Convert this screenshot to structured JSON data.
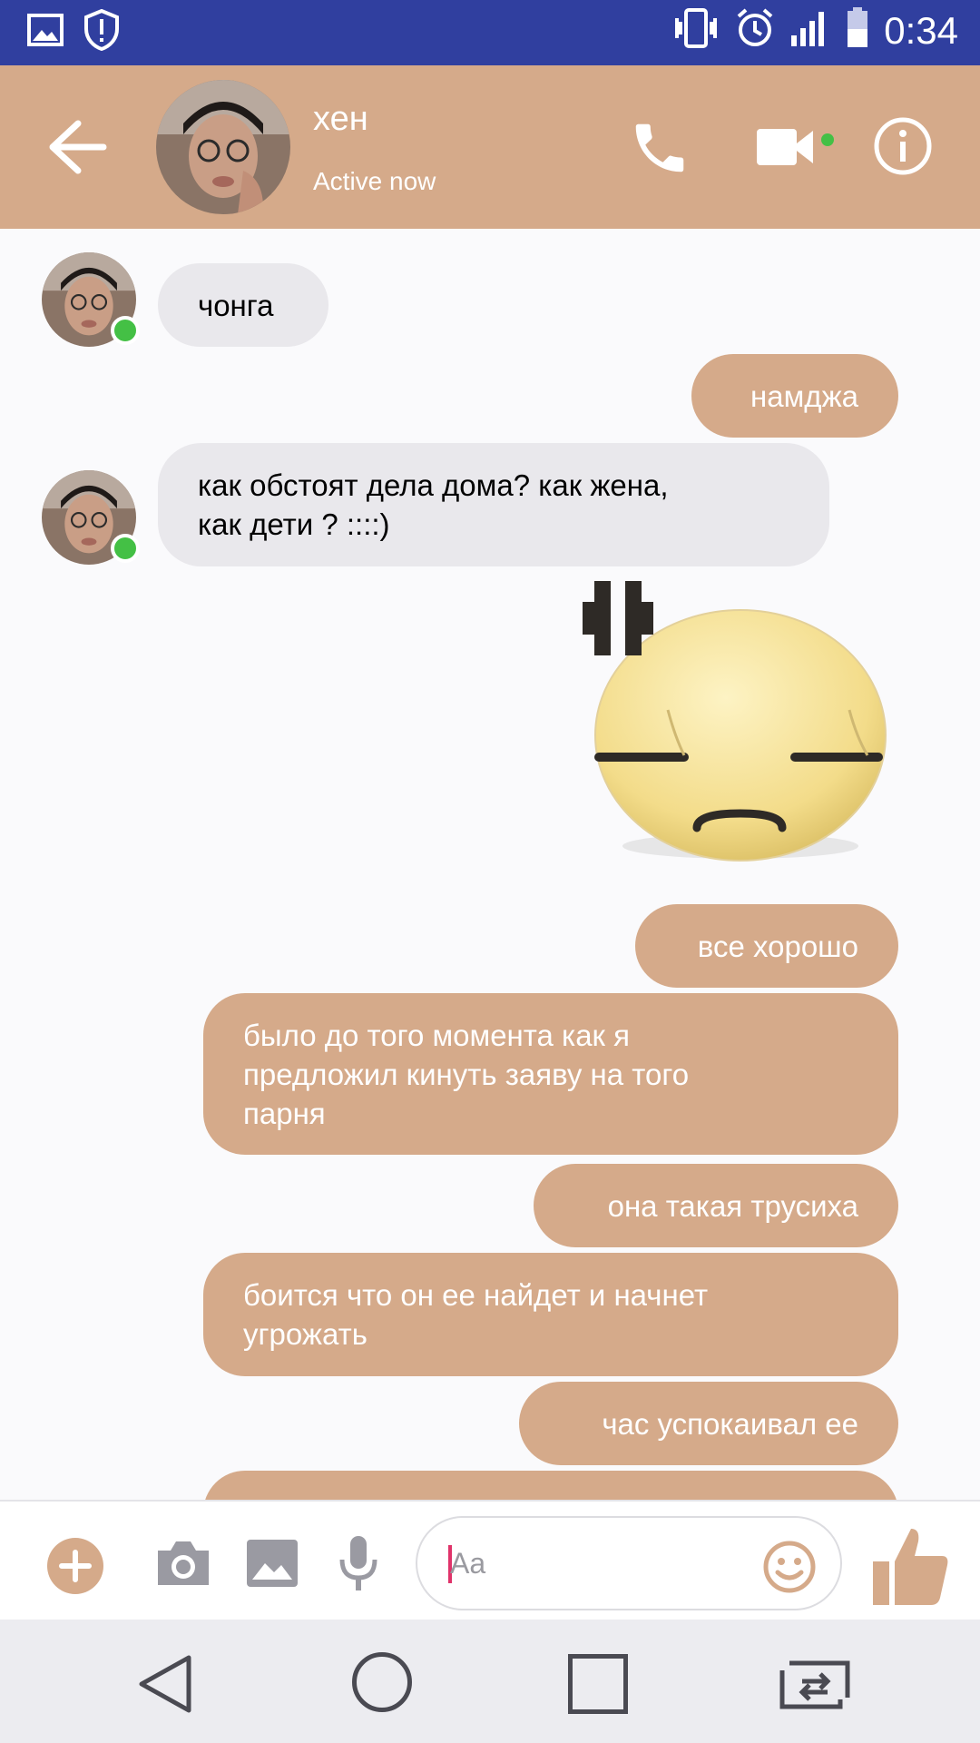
{
  "status_bar": {
    "time": "0:34",
    "left_icons": [
      "image-icon",
      "shield-alert-icon"
    ],
    "right_icons": [
      "vibrate-icon",
      "alarm-icon",
      "signal-icon",
      "battery-icon"
    ]
  },
  "header": {
    "contact_name": "хен",
    "status": "Active now",
    "accent_color": "#d5aa8a",
    "online_color": "#44c045"
  },
  "messages": [
    {
      "direction": "in",
      "text": "чонга",
      "avatar": true
    },
    {
      "direction": "out",
      "text": "намджа"
    },
    {
      "direction": "in",
      "text": "как обстоят дела дома? как жена,\nкак дети ? ::::)",
      "avatar": true
    },
    {
      "direction": "out",
      "type": "sticker",
      "sticker": "annoyed-face-sticker"
    },
    {
      "direction": "out",
      "text": "все хорошо"
    },
    {
      "direction": "out",
      "text": "было до того момента как я\nпредложил кинуть заяву на того\nпарня"
    },
    {
      "direction": "out",
      "text": "она такая трусиха"
    },
    {
      "direction": "out",
      "text": "боится что он ее найдет и начнет\nугрожать"
    },
    {
      "direction": "out",
      "text": "час успокаивал ее"
    }
  ],
  "composer": {
    "placeholder": "Aa",
    "icons": [
      "plus-icon",
      "camera-icon",
      "gallery-icon",
      "mic-icon",
      "emoji-icon",
      "thumbs-up-icon"
    ]
  },
  "navbar": {
    "icons": [
      "back-triangle-icon",
      "home-circle-icon",
      "recents-square-icon",
      "switch-app-icon"
    ]
  }
}
